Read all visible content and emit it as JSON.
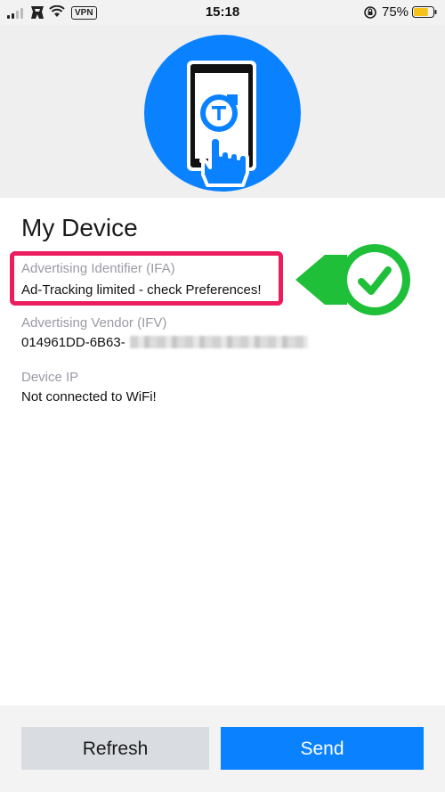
{
  "status_bar": {
    "time": "15:18",
    "vpn_label": "VPN",
    "battery_percent": "75%",
    "battery_level": 0.75,
    "icons": [
      "signal-icon",
      "transformer-logo-icon",
      "wifi-icon",
      "rotation-lock-icon",
      "battery-icon"
    ]
  },
  "header": {
    "illustration": "phone-tap-icon",
    "accent_color": "#0a82ff"
  },
  "page": {
    "title": "My Device"
  },
  "fields": {
    "ifa": {
      "label": "Advertising Identifier (IFA)",
      "value": "Ad-Tracking limited - check Preferences!"
    },
    "ifv": {
      "label": "Advertising Vendor (IFV)",
      "value": "014961DD-6B63-"
    },
    "ip": {
      "label": "Device IP",
      "value": "Not connected to WiFi!"
    }
  },
  "annotation": {
    "highlight_color": "#ec1d5e",
    "check_color": "#1fbf3a"
  },
  "actions": {
    "refresh_label": "Refresh",
    "send_label": "Send"
  }
}
